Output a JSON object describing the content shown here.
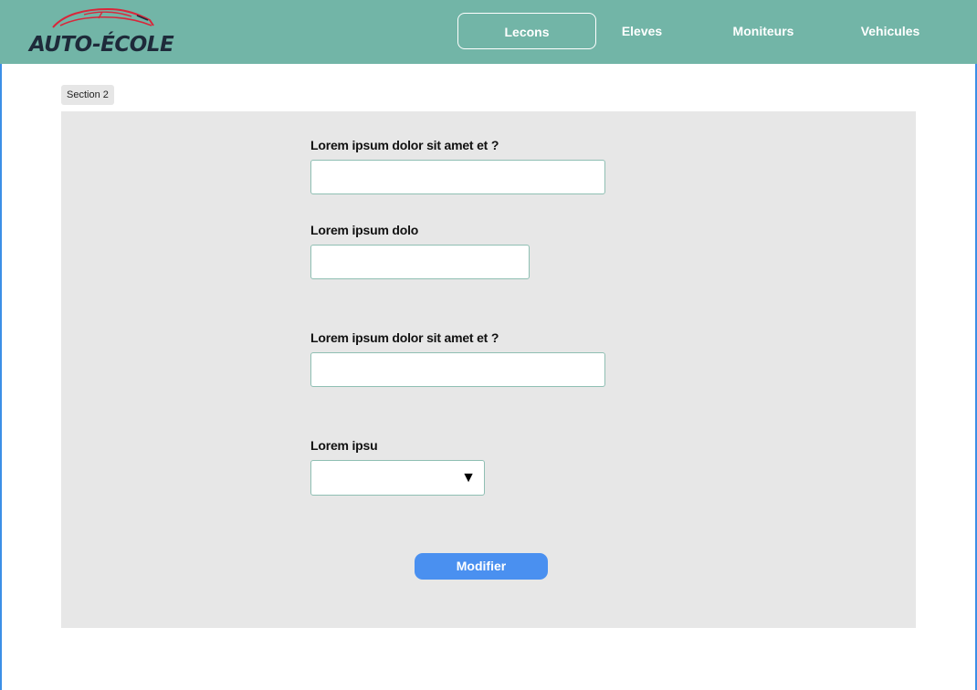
{
  "brand": {
    "logo_text": "AUTO-ÉCOLE",
    "text_color": "#1e2a3a",
    "car_outline_color": "#d9263a"
  },
  "nav": {
    "items": [
      {
        "label": "Lecons",
        "active": true
      },
      {
        "label": "Eleves",
        "active": false
      },
      {
        "label": "Moniteurs",
        "active": false
      },
      {
        "label": "Vehicules",
        "active": false
      }
    ],
    "background": "#72b5a7"
  },
  "section": {
    "label": "Section 2"
  },
  "form": {
    "fields": [
      {
        "label": "Lorem ipsum dolor sit amet et ?",
        "value": ""
      },
      {
        "label": "Lorem ipsum dolo",
        "value": ""
      },
      {
        "label": "Lorem ipsum dolor sit amet et ?",
        "value": ""
      }
    ],
    "select": {
      "label": "Lorem ipsu",
      "value": "",
      "icon": "triangle-down-icon"
    },
    "submit_label": "Modifier",
    "submit_color": "#4a90f0"
  }
}
